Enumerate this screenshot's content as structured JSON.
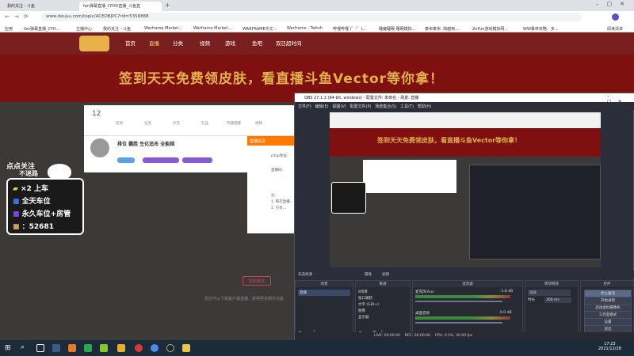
{
  "browser": {
    "tabs": [
      {
        "label": "我的关注 - 斗鱼"
      },
      {
        "label": "fan弹幕直播_CFHD直播_斗鱼直"
      }
    ],
    "url": "www.douyu.com/topic/ACEDBJPC?rid=5356888",
    "bookmarks": [
      "应用",
      "fan弹幕直播_CFH...",
      "主播中心",
      "我的关注 - 斗鱼",
      "Warframe Market...",
      "Warframe Market...",
      "WARFRAME中文...",
      "Warframe - Twitch",
      "哔哩哔哩 (゜-゜)...",
      "睡魔睡眠-睡眠模拟...",
      "泰米泰米: 跨越到...",
      "ZoFun游戏模拟网...",
      "WW暴林攻略 - 多...",
      "阅读清单"
    ]
  },
  "douyu": {
    "nav": [
      "首页",
      "直播",
      "分类",
      "视频",
      "游戏",
      "鱼吧",
      "双日超时间"
    ],
    "banner": "签到天天免费领皮肤，看直播斗鱼Vector等你拿！",
    "card_count": "12",
    "card_icons": [
      "签到",
      "任务",
      "声音",
      "礼品",
      "开播提醒",
      "视频",
      "鱼丸",
      "分享"
    ],
    "streamer_name": "排位 霸胜 生化追击 全能蹈",
    "streamer_tags": [
      "CFHD",
      "等级",
      "关注"
    ],
    "dialog_title": "直播信息",
    "dialog_lines": [
      "rtmp地址:",
      "直播码:",
      "注:",
      "1. 每次直播...",
      "2. 只有..."
    ],
    "bottom_button": "复制推流",
    "bottom_hint": "您还可以下载客户端直播，获得更多额外功能"
  },
  "overlay": {
    "header": "点点关注",
    "sub": "不迷路",
    "lines": [
      "×2 上车",
      "全天车位",
      "永久车位+房管",
      "：52681"
    ]
  },
  "obs": {
    "title": "OBS 27.1.3 (64-bit, windows) - 配置文件: 未命名 - 场景: 直播",
    "menu": [
      "文件(F)",
      "编辑(E)",
      "视图(V)",
      "配置文件(P)",
      "场景集合(S)",
      "工具(T)",
      "帮助(H)"
    ],
    "bar_label_left": "未选择源",
    "bar_buttons": [
      "属性",
      "滤镜"
    ],
    "docks": {
      "scenes": {
        "title": "场景",
        "items": [
          "直播"
        ]
      },
      "sources": {
        "title": "来源",
        "items": [
          "8场景",
          "窗口捕获",
          "文字 (GDI+)",
          "图像",
          "显示器"
        ]
      },
      "mixer": {
        "title": "混音器",
        "tracks": [
          {
            "name": "麦克风/Aux",
            "level": "-1.8 dB"
          },
          {
            "name": "桌面音频",
            "level": "0.0 dB"
          }
        ]
      },
      "transitions": {
        "title": "转场特效",
        "type": "淡化",
        "duration_label": "时长",
        "duration": "300 ms"
      },
      "controls": {
        "title": "控件",
        "buttons": [
          "停止推流",
          "开始录制",
          "启动虚拟摄像机",
          "工作室模式",
          "设置",
          "退出"
        ]
      }
    },
    "status": [
      "LIVE: 00:00:00",
      "REC: 00:00:00",
      "CPU: 0.5%, 30.00 fps"
    ]
  },
  "taskbar": {
    "time": "17:23",
    "date": "2021/12/28"
  }
}
